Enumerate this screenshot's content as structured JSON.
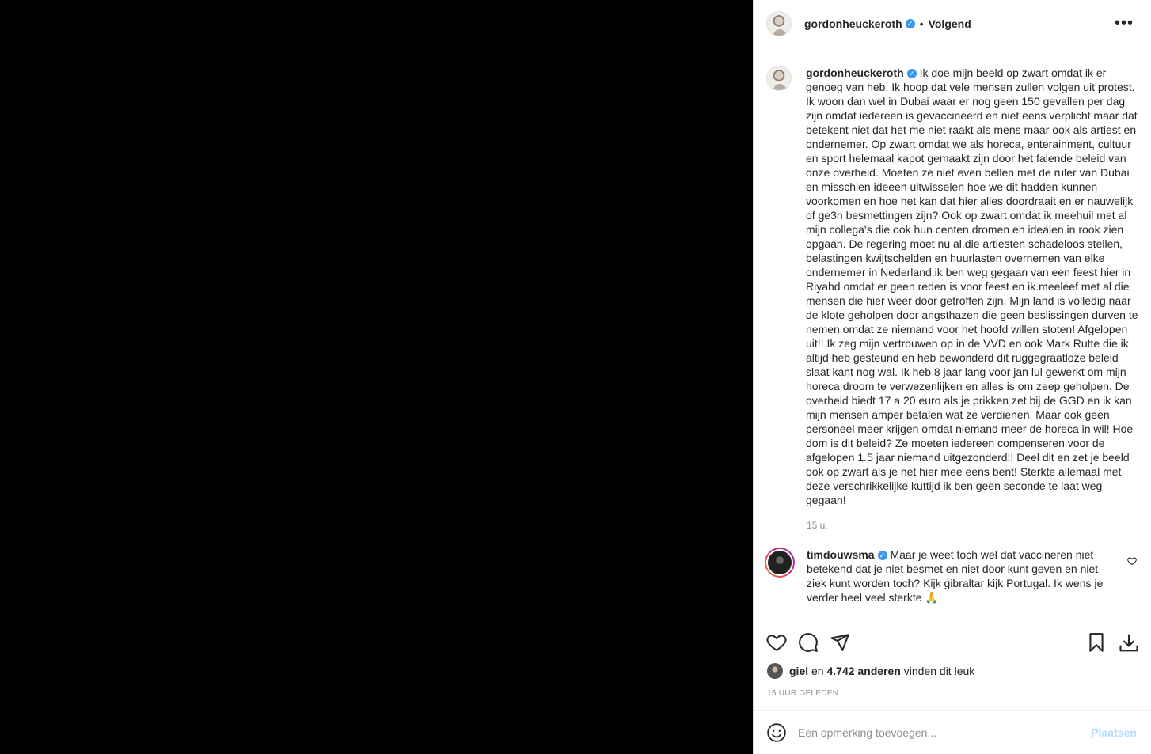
{
  "header": {
    "username": "gordonheuckeroth",
    "separator": "•",
    "follow_status": "Volgend",
    "more_icon": "more-icon"
  },
  "caption": {
    "username": "gordonheuckeroth",
    "text": "Ik doe mijn beeld op zwart omdat ik er genoeg van heb. Ik hoop dat vele mensen zullen volgen uit protest. Ik woon dan wel in Dubai waar er nog geen 150 gevallen per dag zijn omdat iedereen is gevaccineerd en niet eens verplicht maar dat betekent niet dat het me niet raakt als mens maar ook als artiest en ondernemer. Op zwart omdat we als horeca, enterainment, cultuur en sport helemaal kapot gemaakt zijn door het falende beleid van onze overheid. Moeten ze niet even bellen met de ruler van Dubai en misschien ideeen uitwisselen hoe we dit hadden kunnen voorkomen en hoe het kan dat hier alles doordraait en er nauwelijk of ge3n besmettingen zijn? Ook op zwart omdat ik meehuil met al mijn collega's die ook hun centen dromen en idealen in rook zien opgaan. De regering moet nu al.die artiesten schadeloos stellen, belastingen kwijtschelden en huurlasten overnemen van elke ondernemer in Nederland.ik ben weg gegaan van een feest hier in Riyahd omdat er geen reden is voor feest en ik.meeleef met al die mensen die hier weer door getroffen zijn. Mijn land is volledig naar de klote geholpen door angsthazen die geen beslissingen durven te nemen omdat ze niemand voor het hoofd willen stoten! Afgelopen uit!! Ik zeg mijn vertrouwen op in de VVD en ook Mark Rutte die ik altijd heb gesteund en heb bewonderd dit ruggegraatloze beleid slaat kant nog wal. Ik heb 8 jaar lang voor jan lul gewerkt om mijn horeca droom te verwezenlijken en alles is om zeep geholpen. De overheid biedt 17 a 20 euro als je prikken zet bij de GGD en ik kan mijn mensen amper betalen wat ze verdienen. Maar ook geen personeel meer krijgen omdat niemand meer de horeca in wil! Hoe dom is dit beleid? Ze moeten iedereen compenseren voor de afgelopen 1.5 jaar niemand uitgezonderd!! Deel dit en zet je beeld ook op zwart als je het hier mee eens bent! Sterkte allemaal met deze verschrikkelijke kuttijd ik ben geen seconde te laat weg gegaan!",
    "time": "15 u."
  },
  "comment": {
    "username": "timdouwsma",
    "text": "Maar je weet toch wel dat vaccineren niet betekend dat je niet besmet en niet door kunt geven en niet ziek kunt worden toch? Kijk gibraltar kijk Portugal. Ik wens je verder heel veel sterkte 🙏"
  },
  "actions": {
    "icons": [
      "heart-icon",
      "comment-icon",
      "share-icon",
      "bookmark-icon",
      "download-icon"
    ]
  },
  "likes": {
    "first_user": "giel",
    "connector": "en",
    "others": "4.742 anderen",
    "suffix": "vinden dit leuk"
  },
  "posted_ago": "15 UUR GELEDEN",
  "comment_input": {
    "placeholder": "Een opmerking toevoegen...",
    "post_label": "Plaatsen"
  },
  "colors": {
    "verified": "#3897f0",
    "post_button_disabled": "#b3dbff",
    "muted_text": "#8e8e8e"
  }
}
